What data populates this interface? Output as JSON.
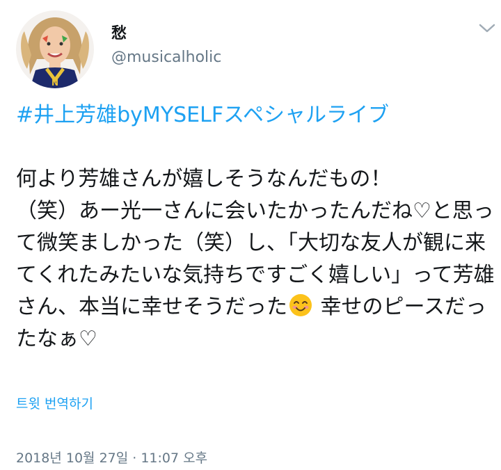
{
  "user": {
    "display_name": "愁",
    "handle": "@musicalholic",
    "avatar_icon": "profile-photo"
  },
  "tweet": {
    "hashtag": "#井上芳雄byMYSELFスペシャルライブ",
    "text_before_emoji": "何より芳雄さんが嬉しそうなんだもの！\n（笑）あー光一さんに会いたかったんだね♡と思って微笑ましかった（笑）し、「大切な友人が観に来てくれたみたいな気持ちですごく嬉しい」って芳雄さん、本当に幸せそうだった",
    "emoji_icon": "smiling-face-emoji",
    "text_after_emoji": " 幸せのピースだったなぁ♡"
  },
  "actions": {
    "translate_label": "트윗 번역하기"
  },
  "meta": {
    "timestamp": "2018년 10월 27일 · 11:07 오후"
  },
  "colors": {
    "link": "#1da1f2",
    "secondary_text": "#657786",
    "primary_text": "#14171a"
  }
}
